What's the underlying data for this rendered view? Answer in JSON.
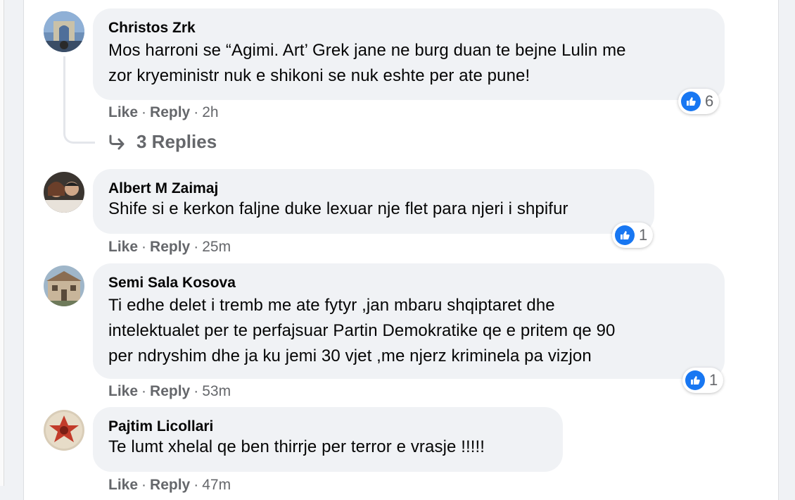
{
  "comments": [
    {
      "author": "Christos Zrk",
      "text_lines": [
        "Mos harroni se “Agimi. Art’ Grek jane ne burg duan te bejne Lulin me",
        "zor kryeministr nuk e shikoni se nuk eshte per ate pune!"
      ],
      "like": "Like",
      "reply": "Reply",
      "time": "2h",
      "sep": "·",
      "reactions": "6",
      "replies": "3 Replies",
      "avatar": "christos-avatar"
    },
    {
      "author": "Albert M Zaimaj",
      "text_lines": [
        "Shife si e kerkon faljne duke lexuar nje flet para njeri i shpifur"
      ],
      "like": "Like",
      "reply": "Reply",
      "time": "25m",
      "sep": "·",
      "reactions": "1",
      "avatar": "albert-avatar"
    },
    {
      "author": "Semi Sala Kosova",
      "text_lines": [
        "Ti edhe delet i tremb me ate fytyr ,jan mbaru shqiptaret dhe",
        "intelektualet per te perfajsuar Partin Demokratike qe e pritem qe 90",
        "per ndryshim dhe ja ku jemi 30 vjet ,me njerz kriminela pa vizjon"
      ],
      "like": "Like",
      "reply": "Reply",
      "time": "53m",
      "sep": "·",
      "reactions": "1",
      "avatar": "semi-avatar"
    },
    {
      "author": "Pajtim Licollari",
      "text_lines": [
        "Te lumt xhelal qe ben thirrje per terror e vrasje !!!!!"
      ],
      "like": "Like",
      "reply": "Reply",
      "time": "47m",
      "sep": "·",
      "avatar": "pajtim-avatar"
    }
  ],
  "colors": {
    "like_blue": "#1877f2",
    "bubble": "#f0f2f5",
    "meta": "#65676b"
  },
  "icons": {
    "like": "like-thumb-icon",
    "reply_arrow": "reply-arrow-icon"
  }
}
